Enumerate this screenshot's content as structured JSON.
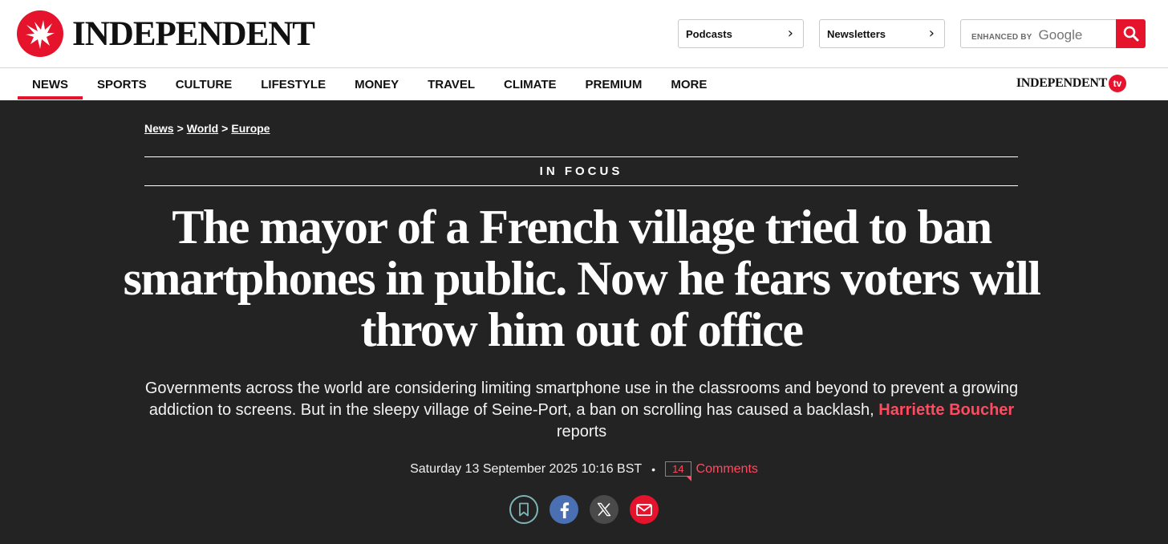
{
  "header": {
    "logo_text": "INDEPENDENT",
    "podcasts_label": "Podcasts",
    "newsletters_label": "Newsletters",
    "search": {
      "enhanced_label": "ENHANCED BY",
      "google_label": "Google",
      "placeholder": ""
    }
  },
  "nav": {
    "items": [
      "NEWS",
      "SPORTS",
      "CULTURE",
      "LIFESTYLE",
      "MONEY",
      "TRAVEL",
      "CLIMATE",
      "PREMIUM",
      "MORE"
    ],
    "active": "NEWS",
    "tv_brand": "INDEPENDENT",
    "tv_badge": "tv"
  },
  "breadcrumb": [
    "News",
    "World",
    "Europe"
  ],
  "breadcrumb_separator": ">",
  "article": {
    "kicker": "IN FOCUS",
    "headline": "The mayor of a French village tried to ban smartphones in public. Now he fears voters will throw him out of office",
    "standfirst": "Governments across the world are considering limiting smartphone use in the classrooms and beyond to prevent a growing addiction to screens. But in the sleepy village of Seine-Port, a ban on scrolling has caused a backlash,",
    "author": "Harriette Boucher",
    "author_suffix": "reports",
    "date": "Saturday 13 September 2025 10:16 BST",
    "meta_separator": "•",
    "comment_count": "14",
    "comments_label": "Comments"
  },
  "share": [
    "bookmark-icon",
    "facebook-icon",
    "x-icon",
    "email-icon"
  ],
  "colors": {
    "brand_red": "#e5132b",
    "author_red": "#ff4a5f",
    "hero_bg": "#232323"
  }
}
